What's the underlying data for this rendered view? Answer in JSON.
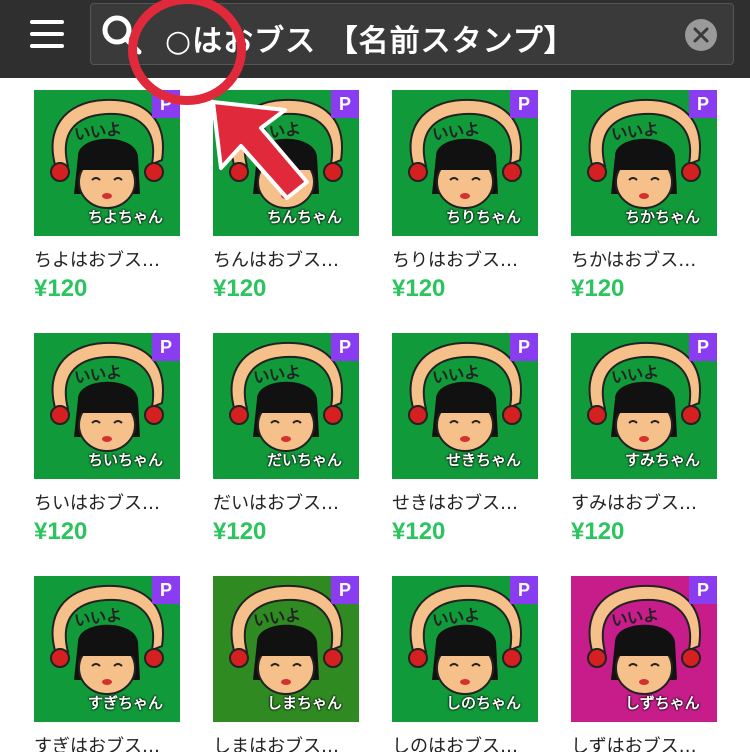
{
  "header": {
    "search_query": "○はおブス 【名前スタンプ】"
  },
  "colors": {
    "topbar": "#2f2f2f",
    "price": "#2bc45f",
    "premium_badge": "#8a3df0",
    "thumb_green": "#119a3a",
    "thumb_dark_green": "#2f8a22",
    "thumb_magenta": "#c61d8a",
    "annotation": "#e02a3c"
  },
  "items": [
    {
      "title": "ちよはおブス…",
      "price": "¥120",
      "badge": "P",
      "image_caption": "ちよちゃん",
      "image_greeting": "いいよ",
      "bg": "green"
    },
    {
      "title": "ちんはおブス…",
      "price": "¥120",
      "badge": "P",
      "image_caption": "ちんちゃん",
      "image_greeting": "いいよ",
      "bg": "green"
    },
    {
      "title": "ちりはおブス…",
      "price": "¥120",
      "badge": "P",
      "image_caption": "ちりちゃん",
      "image_greeting": "いいよ",
      "bg": "green"
    },
    {
      "title": "ちかはおブス…",
      "price": "¥120",
      "badge": "P",
      "image_caption": "ちかちゃん",
      "image_greeting": "いいよ",
      "bg": "green"
    },
    {
      "title": "ちいはおブス…",
      "price": "¥120",
      "badge": "P",
      "image_caption": "ちいちゃん",
      "image_greeting": "いいよ",
      "bg": "green"
    },
    {
      "title": "だいはおブス…",
      "price": "¥120",
      "badge": "P",
      "image_caption": "だいちゃん",
      "image_greeting": "いいよ",
      "bg": "green"
    },
    {
      "title": "せきはおブス…",
      "price": "¥120",
      "badge": "P",
      "image_caption": "せきちゃん",
      "image_greeting": "いいよ",
      "bg": "green"
    },
    {
      "title": "すみはおブス…",
      "price": "¥120",
      "badge": "P",
      "image_caption": "すみちゃん",
      "image_greeting": "いいよ",
      "bg": "green"
    },
    {
      "title": "すぎはおブス…",
      "price": "",
      "badge": "P",
      "image_caption": "すぎちゃん",
      "image_greeting": "いいよ",
      "bg": "green"
    },
    {
      "title": "しまはおブス…",
      "price": "",
      "badge": "P",
      "image_caption": "しまちゃん",
      "image_greeting": "いいよ",
      "bg": "darkgreen"
    },
    {
      "title": "しのはおブス…",
      "price": "",
      "badge": "P",
      "image_caption": "しのちゃん",
      "image_greeting": "いいよ",
      "bg": "green"
    },
    {
      "title": "しずはおブス…",
      "price": "",
      "badge": "P",
      "image_caption": "しずちゃん",
      "image_greeting": "いいよ",
      "bg": "magenta"
    }
  ]
}
